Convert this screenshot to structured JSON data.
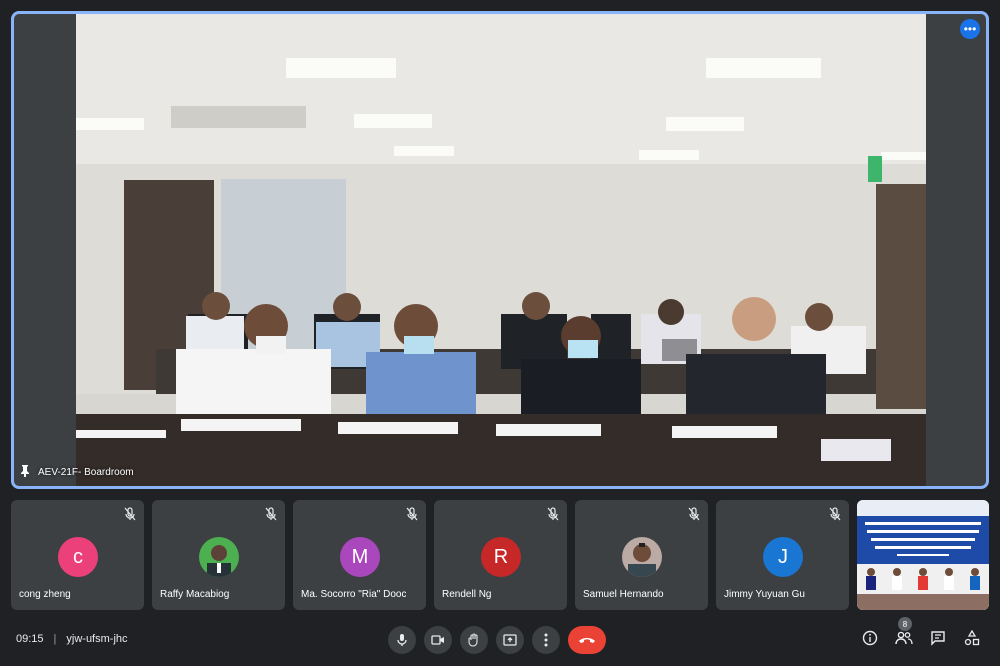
{
  "main": {
    "pinned_label": "AEV-21F- Boardroom",
    "more_icon": "more-horiz-icon"
  },
  "participants": [
    {
      "name": "cong zheng",
      "initial": "c",
      "color": "#ec407a",
      "type": "initial"
    },
    {
      "name": "Raffy Macabiog",
      "initial": "",
      "color": "#4caf50",
      "type": "photo"
    },
    {
      "name": "Ma. Socorro \"Ria\" Dooc",
      "initial": "M",
      "color": "#ab47bc",
      "type": "initial"
    },
    {
      "name": "Rendell Ng",
      "initial": "R",
      "color": "#c62828",
      "type": "initial"
    },
    {
      "name": "Samuel Hernando",
      "initial": "",
      "color": "#8d6e63",
      "type": "photo"
    },
    {
      "name": "Jimmy Yuyuan Gu",
      "initial": "J",
      "color": "#1976d2",
      "type": "initial"
    }
  ],
  "footer": {
    "time": "09:15",
    "meeting_code": "yjw-ufsm-jhc",
    "people_count": "8"
  },
  "colors": {
    "accent": "#8ab4f8",
    "end_call": "#ea4335"
  }
}
